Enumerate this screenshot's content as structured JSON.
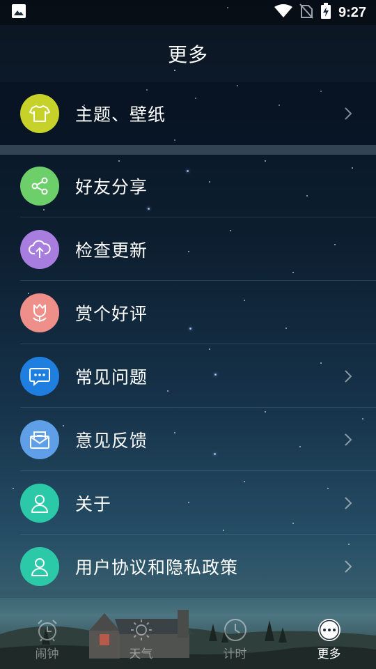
{
  "status_bar": {
    "time": "9:27",
    "icons": [
      "image-icon",
      "wifi-icon",
      "no-sim-icon",
      "battery-charging-icon"
    ]
  },
  "header": {
    "title": "更多"
  },
  "menu_top": [
    {
      "label": "主题、壁纸",
      "icon": "tshirt-icon",
      "color": "#c6d12a",
      "chevron": true
    }
  ],
  "menu": [
    {
      "label": "好友分享",
      "icon": "share-icon",
      "color": "#6ccf6a",
      "chevron": false
    },
    {
      "label": "检查更新",
      "icon": "cloud-upload-icon",
      "color": "#a77ee0",
      "chevron": false
    },
    {
      "label": "赏个好评",
      "icon": "tulip-icon",
      "color": "#ef8f8a",
      "chevron": false
    },
    {
      "label": "常见问题",
      "icon": "chat-bubble-icon",
      "color": "#1f7fe0",
      "chevron": true
    },
    {
      "label": "意见反馈",
      "icon": "mail-icon",
      "color": "#5e9fe8",
      "chevron": true
    },
    {
      "label": "关于",
      "icon": "user-icon",
      "color": "#2bc9a8",
      "chevron": true
    },
    {
      "label": "用户协议和隐私政策",
      "icon": "user-icon",
      "color": "#2bc9a8",
      "chevron": true
    }
  ],
  "bottom_nav": [
    {
      "label": "闹钟",
      "icon": "alarm-clock-icon",
      "active": false
    },
    {
      "label": "天气",
      "icon": "sun-icon",
      "active": false
    },
    {
      "label": "计时",
      "icon": "clock-icon",
      "active": false
    },
    {
      "label": "更多",
      "icon": "more-icon",
      "active": true
    }
  ]
}
